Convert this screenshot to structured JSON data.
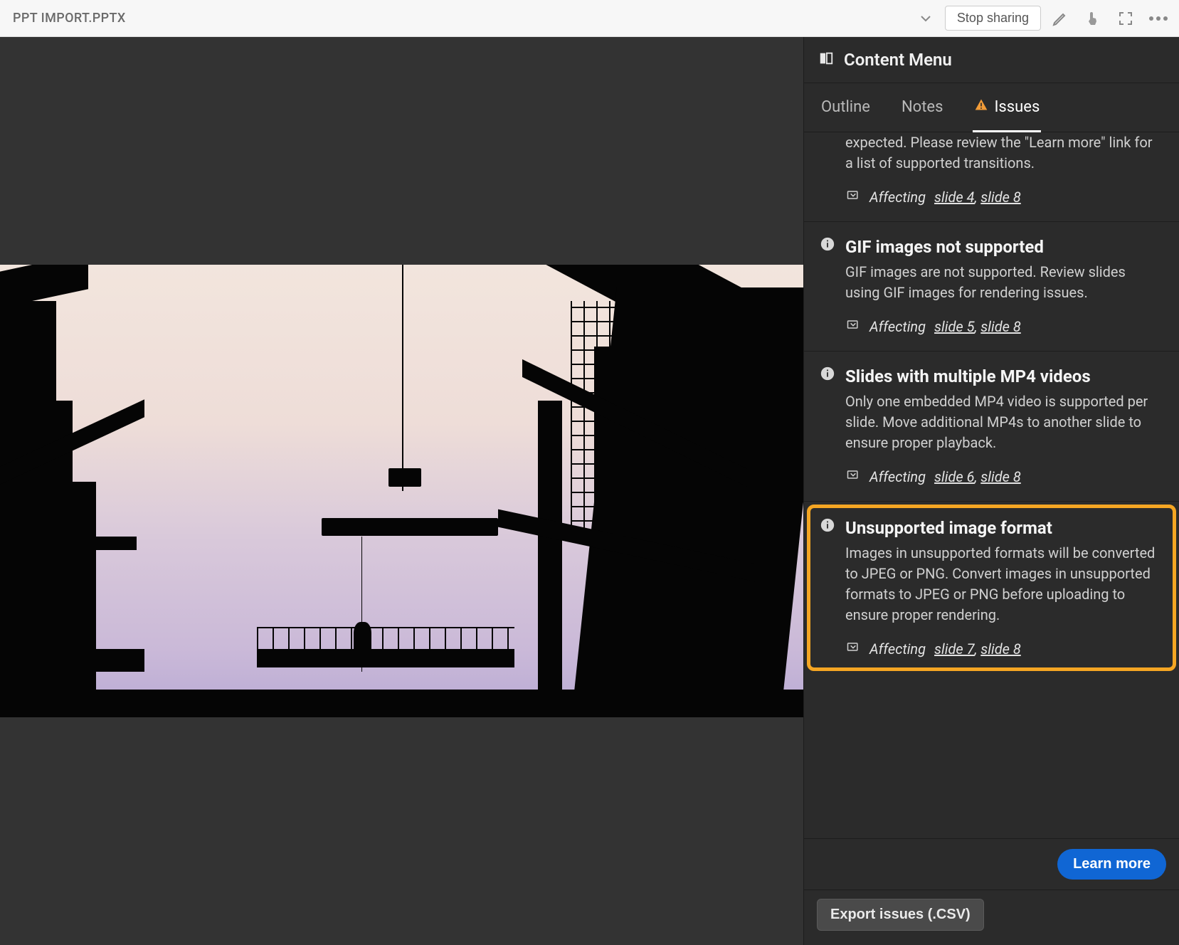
{
  "topbar": {
    "file_title": "PPT IMPORT.PPTX",
    "stop_sharing": "Stop sharing"
  },
  "panel": {
    "title": "Content Menu",
    "tabs": {
      "outline": "Outline",
      "notes": "Notes",
      "issues": "Issues"
    },
    "affecting_prefix": "Affecting",
    "learn_more": "Learn more",
    "export": "Export issues (.CSV)",
    "issues": [
      {
        "cut_top": true,
        "desc_partial": "expected. Please review the \"Learn more\" link for a list of supported transitions.",
        "slides": [
          "slide 4",
          "slide 8"
        ]
      },
      {
        "title": "GIF images not supported",
        "desc": "GIF images are not supported. Review slides using GIF images for rendering issues.",
        "slides": [
          "slide 5",
          "slide 8"
        ]
      },
      {
        "title": "Slides with multiple MP4 videos",
        "desc": "Only one embedded MP4 video is supported per slide. Move additional MP4s to another slide to ensure proper playback.",
        "slides": [
          "slide 6",
          "slide 8"
        ]
      },
      {
        "highlighted": true,
        "title": "Unsupported image format",
        "desc": "Images in unsupported formats will be converted to JPEG or PNG. Convert images in unsupported formats to JPEG or PNG before uploading to ensure proper rendering.",
        "slides": [
          "slide 7",
          "slide 8"
        ]
      }
    ]
  }
}
